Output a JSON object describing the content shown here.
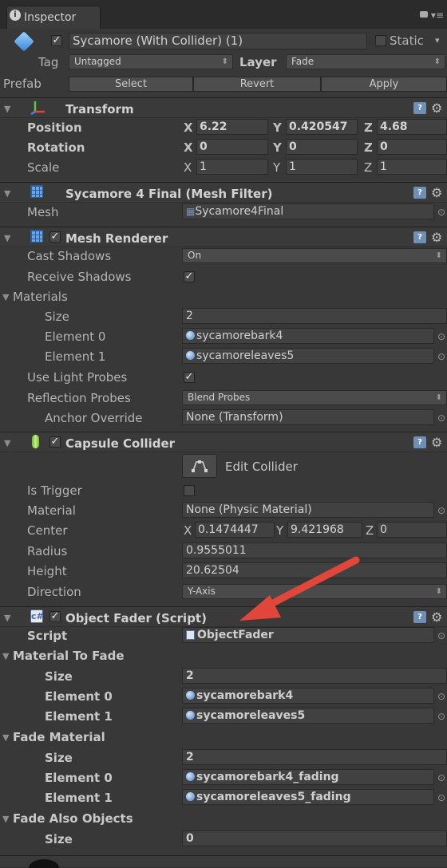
{
  "window": {
    "tab_label": "Inspector"
  },
  "object": {
    "name": "Sycamore (With Collider) (1)",
    "static_label": "Static",
    "tag_label": "Tag",
    "tag_value": "Untagged",
    "layer_label": "Layer",
    "layer_value": "Fade",
    "prefab_label": "Prefab",
    "select_label": "Select",
    "revert_label": "Revert",
    "apply_label": "Apply"
  },
  "transform": {
    "title": "Transform",
    "position_label": "Position",
    "rotation_label": "Rotation",
    "scale_label": "Scale",
    "x": "X",
    "y": "Y",
    "z": "Z",
    "position": [
      "6.22",
      "0.420547",
      "4.68"
    ],
    "rotation": [
      "0",
      "0",
      "0"
    ],
    "scale": [
      "1",
      "1",
      "1"
    ]
  },
  "mesh_filter": {
    "title": "Sycamore 4 Final (Mesh Filter)",
    "mesh_label": "Mesh",
    "mesh_value": "Sycamore4Final"
  },
  "mesh_renderer": {
    "title": "Mesh Renderer",
    "cast_shadows_label": "Cast Shadows",
    "cast_shadows_value": "On",
    "receive_shadows_label": "Receive Shadows",
    "materials_label": "Materials",
    "size_label": "Size",
    "size_value": "2",
    "element0_label": "Element 0",
    "element0_value": "sycamorebark4",
    "element1_label": "Element 1",
    "element1_value": "sycamoreleaves5",
    "light_probes_label": "Use Light Probes",
    "reflection_label": "Reflection Probes",
    "reflection_value": "Blend Probes",
    "anchor_label": "Anchor Override",
    "anchor_value": "None (Transform)"
  },
  "capsule_collider": {
    "title": "Capsule Collider",
    "edit_label": "Edit Collider",
    "trigger_label": "Is Trigger",
    "material_label": "Material",
    "material_value": "None (Physic Material)",
    "center_label": "Center",
    "center": [
      "0.1474447",
      "9.421968",
      "0"
    ],
    "radius_label": "Radius",
    "radius_value": "0.9555011",
    "height_label": "Height",
    "height_value": "20.62504",
    "direction_label": "Direction",
    "direction_value": "Y-Axis"
  },
  "object_fader": {
    "title": "Object Fader (Script)",
    "script_label": "Script",
    "script_value": "ObjectFader",
    "material_to_fade_label": "Material To Fade",
    "mtf_size_label": "Size",
    "mtf_size_value": "2",
    "mtf_e0_label": "Element 0",
    "mtf_e0_value": "sycamorebark4",
    "mtf_e1_label": "Element 1",
    "mtf_e1_value": "sycamoreleaves5",
    "fade_material_label": "Fade Material",
    "fm_size_label": "Size",
    "fm_size_value": "2",
    "fm_e0_label": "Element 0",
    "fm_e0_value": "sycamorebark4_fading",
    "fm_e1_label": "Element 1",
    "fm_e1_value": "sycamoreleaves5_fading",
    "fade_also_label": "Fade Also Objects",
    "fao_size_label": "Size",
    "fao_size_value": "0"
  },
  "colors": {
    "annotation_arrow": "#e0463a",
    "background": "#383838"
  }
}
